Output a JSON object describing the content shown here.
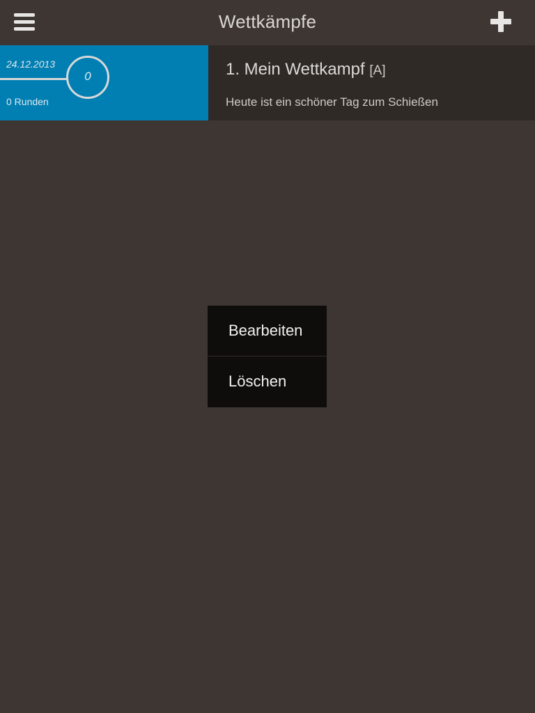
{
  "header": {
    "title": "Wettkämpfe",
    "menu_icon": "hamburger-menu-icon",
    "add_icon": "plus-icon"
  },
  "competitions": [
    {
      "date": "24.12.2013",
      "score": "0",
      "rounds": "0 Runden",
      "title": "1. Mein Wettkampf",
      "tag": "[A]",
      "description": "Heute ist ein schöner Tag zum Schießen"
    }
  ],
  "context_menu": {
    "edit_label": "Bearbeiten",
    "delete_label": "Löschen"
  },
  "colors": {
    "background": "#3e3632",
    "accent": "#027fb2",
    "row_background": "#302a27",
    "menu_background": "#0f0d0c"
  }
}
